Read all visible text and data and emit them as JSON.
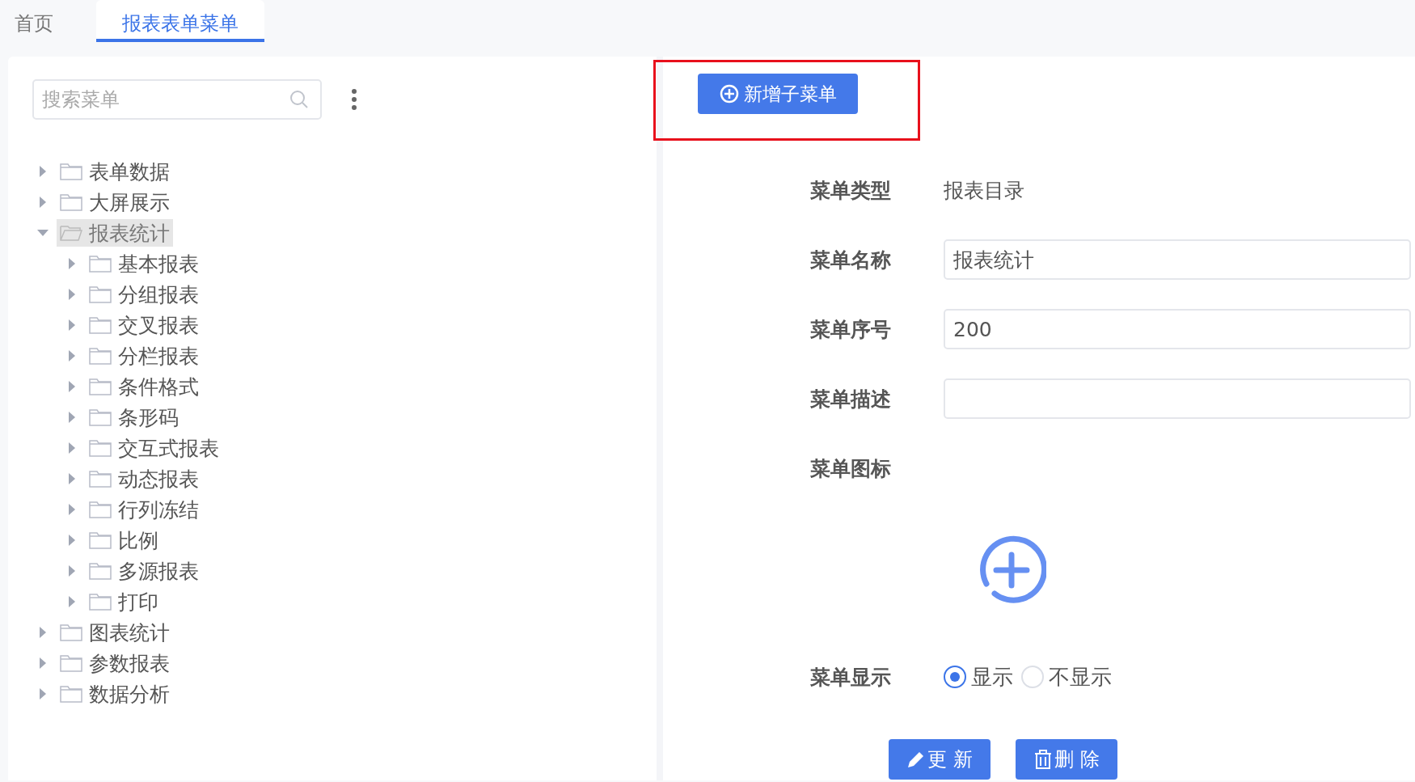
{
  "tabs": [
    {
      "label": "首页",
      "selected": false
    },
    {
      "label": "报表表单菜单",
      "selected": true
    }
  ],
  "sidebar": {
    "search": {
      "placeholder": "搜索菜单"
    },
    "tree": [
      {
        "label": "表单数据",
        "expanded": false,
        "selected": false
      },
      {
        "label": "大屏展示",
        "expanded": false,
        "selected": false
      },
      {
        "label": "报表统计",
        "expanded": true,
        "selected": true,
        "children": [
          {
            "label": "基本报表",
            "expanded": false,
            "selected": false
          },
          {
            "label": "分组报表",
            "expanded": false,
            "selected": false
          },
          {
            "label": "交叉报表",
            "expanded": false,
            "selected": false
          },
          {
            "label": "分栏报表",
            "expanded": false,
            "selected": false
          },
          {
            "label": "条件格式",
            "expanded": false,
            "selected": false
          },
          {
            "label": "条形码",
            "expanded": false,
            "selected": false
          },
          {
            "label": "交互式报表",
            "expanded": false,
            "selected": false
          },
          {
            "label": "动态报表",
            "expanded": false,
            "selected": false
          },
          {
            "label": "行列冻结",
            "expanded": false,
            "selected": false
          },
          {
            "label": "比例",
            "expanded": false,
            "selected": false
          },
          {
            "label": "多源报表",
            "expanded": false,
            "selected": false
          },
          {
            "label": "打印",
            "expanded": false,
            "selected": false
          }
        ]
      },
      {
        "label": "图表统计",
        "expanded": false,
        "selected": false
      },
      {
        "label": "参数报表",
        "expanded": false,
        "selected": false
      },
      {
        "label": "数据分析",
        "expanded": false,
        "selected": false
      }
    ]
  },
  "toolbar": {
    "highlighted": true,
    "add_button": "新增子菜单"
  },
  "form": [
    {
      "kind": "text",
      "label": "菜单类型",
      "value": "报表目录"
    },
    {
      "kind": "input",
      "label": "菜单名称",
      "value": "报表统计"
    },
    {
      "kind": "input",
      "label": "菜单序号",
      "value": "200"
    },
    {
      "kind": "input",
      "label": "菜单描述"
    },
    {
      "kind": "icon",
      "label": "菜单图标"
    },
    {
      "kind": "radio",
      "label": "菜单显示",
      "options": [
        {
          "label": "显示",
          "selected": true
        },
        {
          "label": "不显示",
          "selected": false
        }
      ]
    }
  ],
  "buttons": [
    {
      "kind": "edit",
      "label": "更 新"
    },
    {
      "kind": "delete",
      "label": "删 除"
    }
  ]
}
